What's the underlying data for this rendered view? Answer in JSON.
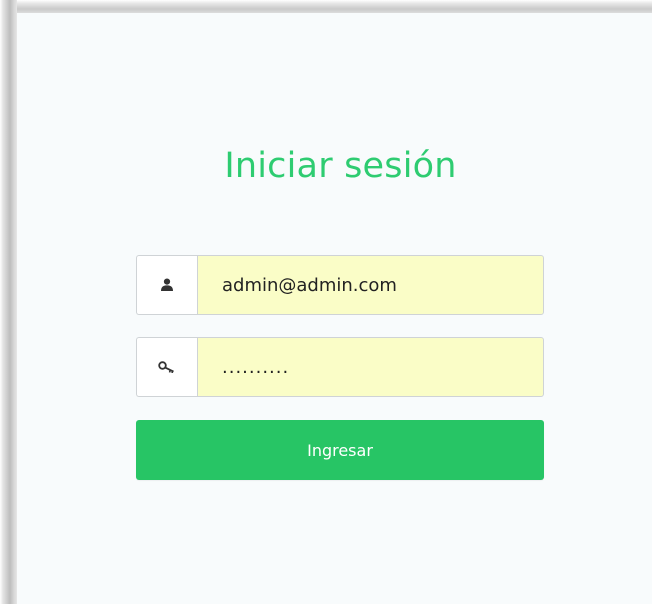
{
  "login": {
    "title": "Iniciar sesión",
    "email_icon": "user-icon",
    "email_value": "admin@admin.com",
    "password_icon": "key-icon",
    "password_value": "..........",
    "submit_label": "Ingresar"
  },
  "colors": {
    "accent": "#2ecc71",
    "button": "#27c565",
    "input_autofill": "#fafdc7"
  }
}
